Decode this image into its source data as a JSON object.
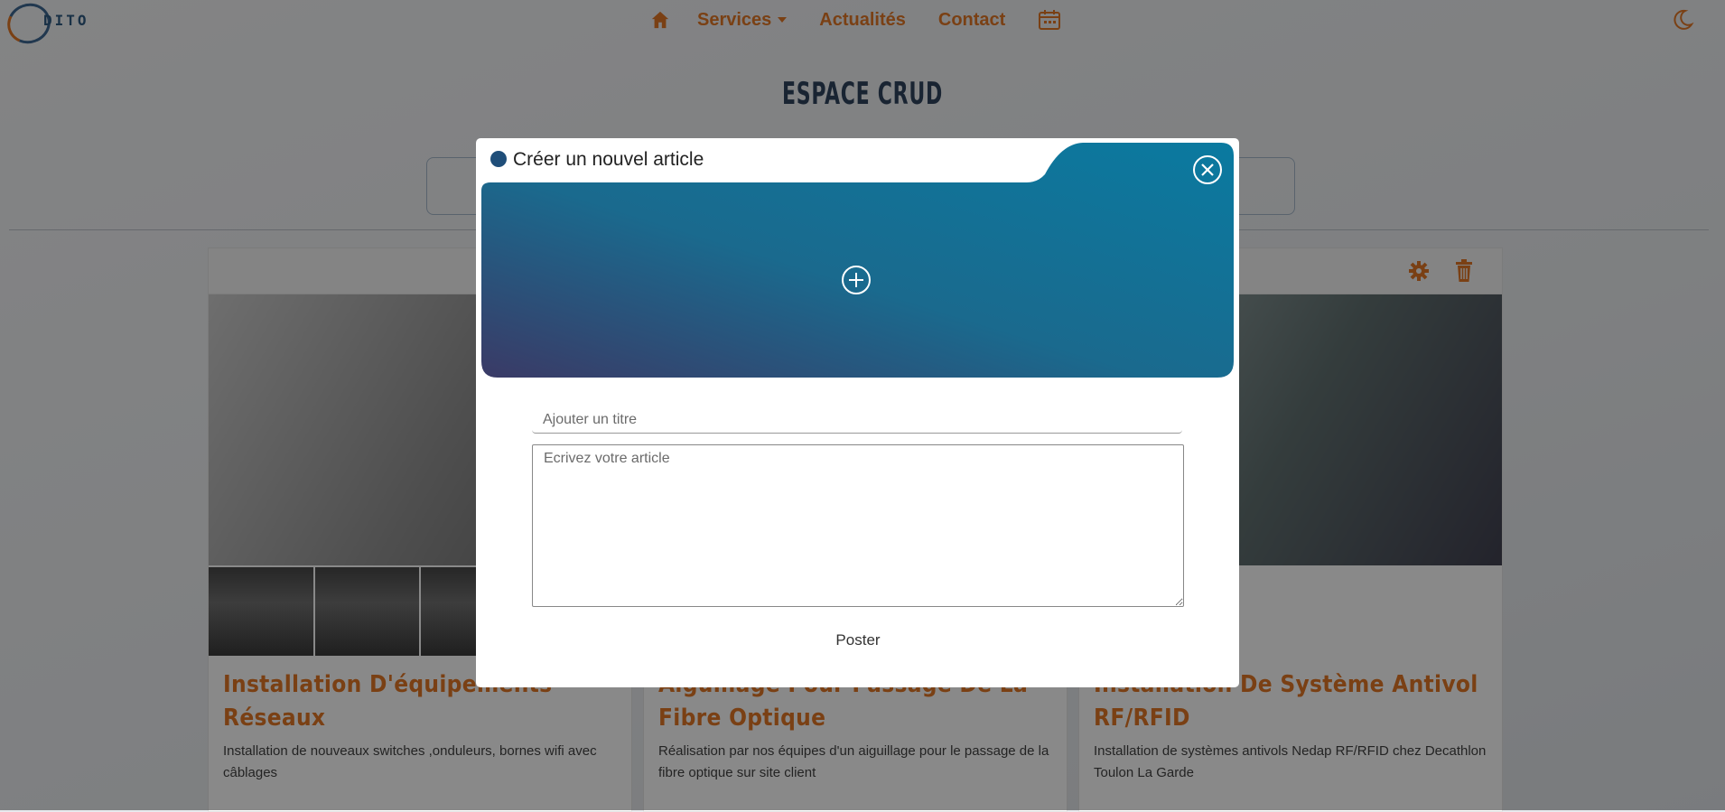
{
  "nav": {
    "logo_text": "DITO",
    "links": [
      "Services",
      "Actualités",
      "Contact"
    ],
    "accent_color": "#e06d14"
  },
  "page": {
    "title": "ESPACE CRUD"
  },
  "cards": [
    {
      "title": "Installation D'équipements Réseaux",
      "text": "Installation de nouveaux switches ,onduleurs, bornes wifi avec câblages"
    },
    {
      "title": "Aiguillage Pour Passage De La Fibre Optique",
      "text": "Réalisation par nos équipes d'un aiguillage pour le passage de la fibre optique sur site client"
    },
    {
      "title": "Installation De Système Antivol RF/RFID",
      "text": "Installation de systèmes antivols Nedap RF/RFID chez Decathlon Toulon La Garde"
    }
  ],
  "modal": {
    "title": "Créer un nouvel article",
    "title_placeholder": "Ajouter un titre",
    "article_placeholder": "Ecrivez votre article",
    "post_label": "Poster",
    "header_gradient": [
      "#0a7aa0",
      "#3a3a66"
    ]
  },
  "icons": [
    "home-icon",
    "calendar-icon",
    "moon-icon",
    "gear-icon",
    "trash-icon",
    "close-icon",
    "add-image-icon"
  ]
}
